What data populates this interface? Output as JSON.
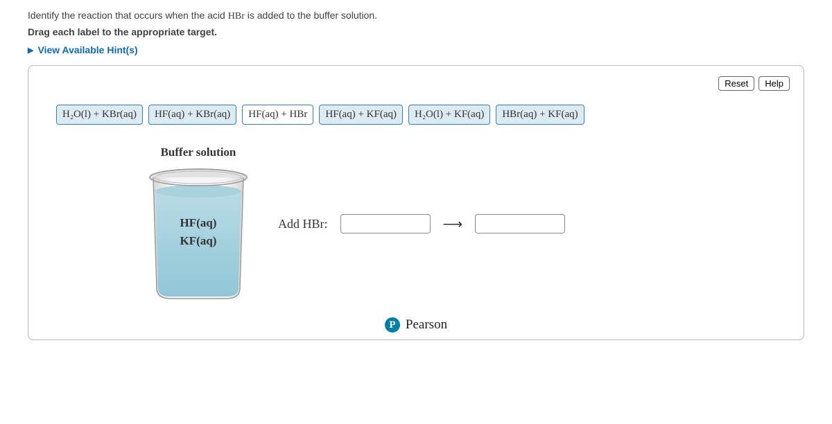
{
  "question": {
    "prefix": "Identify the reaction that occurs when the acid ",
    "chem": "HBr",
    "suffix": " is added to the buffer solution."
  },
  "instruction": "Drag each label to the appropriate target.",
  "hints": "View Available Hint(s)",
  "buttons": {
    "reset": "Reset",
    "help": "Help"
  },
  "labels": [
    "H₂O(l) + KBr(aq)",
    "HF(aq) + KBr(aq)",
    "HF(aq) + HBr",
    "HF(aq) + KF(aq)",
    "H₂O(l) + KF(aq)",
    "HBr(aq) + KF(aq)"
  ],
  "beaker": {
    "title": "Buffer solution",
    "component1": "HF(aq)",
    "component2": "KF(aq)"
  },
  "reaction": {
    "prompt": "Add HBr:",
    "arrow": "⟶"
  },
  "footer": {
    "letter": "P",
    "brand": "Pearson"
  }
}
